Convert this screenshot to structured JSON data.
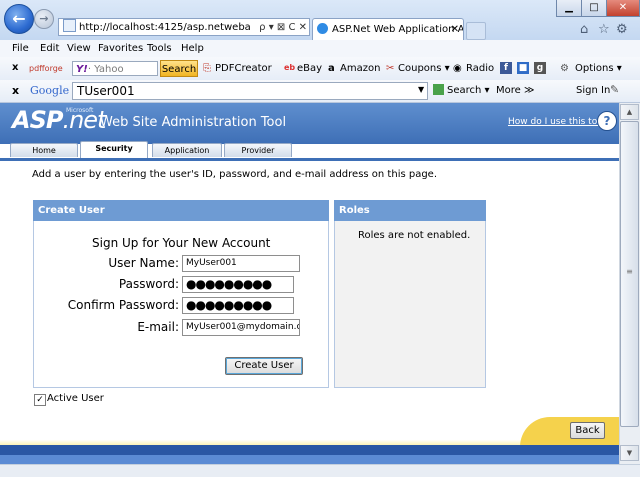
{
  "browser": {
    "address": "http://localhost:4125/asp.netwebadminfi",
    "tab_title": "ASP.Net Web Application A...",
    "back_icon": "←",
    "forward_icon": "→",
    "close_glyph": "✕",
    "min_glyph": "▁",
    "max_glyph": "□",
    "address_tools": "ρ ▾ ⊠ C ✕"
  },
  "menubar": {
    "items": [
      "File",
      "Edit",
      "View",
      "Favorites",
      "Tools",
      "Help"
    ]
  },
  "toolbar1": {
    "close_x": "x",
    "pdfforge": "pdfforge",
    "yahoo_logo": "Y!",
    "yahoo_placeholder": "· Yahoo",
    "search_label": "Search",
    "pdfcreator": "PDFCreator",
    "ebay": "eBay",
    "amazon": "Amazon",
    "coupons": "Coupons ▾",
    "radio": "Radio",
    "options": "Options ▾"
  },
  "toolbar2": {
    "close_x": "x",
    "google_logo": "Google",
    "query": "TUser001",
    "search_label": "Search ▾",
    "more_label": "More ≫",
    "signin_label": "Sign In"
  },
  "page": {
    "logo_main": "ASP",
    "logo_net": ".net",
    "logo_sup": "Microsoft",
    "app_title": "Web Site Administration Tool",
    "help_link": "How do I use this tool?",
    "help_glyph": "?",
    "tabs": [
      "Home",
      "Security",
      "Application",
      "Provider"
    ],
    "active_tab": "Security",
    "intro": "Add a user by entering the user's ID, password, and e-mail address on this page.",
    "create_user": {
      "header": "Create User",
      "title": "Sign Up for Your New Account",
      "username_label": "User Name:",
      "username_value": "MyUser001",
      "password_label": "Password:",
      "password_value": "●●●●●●●●●",
      "confirm_label": "Confirm Password:",
      "confirm_value": "●●●●●●●●●",
      "email_label": "E-mail:",
      "email_value": "MyUser001@mydomain.c",
      "submit_label": "Create User"
    },
    "roles": {
      "header": "Roles",
      "message": "Roles are not enabled."
    },
    "active_user_label": "Active User",
    "active_user_checked": "✓",
    "back_label": "Back"
  },
  "colors": {
    "header_blue": "#3e6fb6",
    "panel_blue": "#6e9bd3",
    "footer_yellow": "#f5d24c"
  }
}
